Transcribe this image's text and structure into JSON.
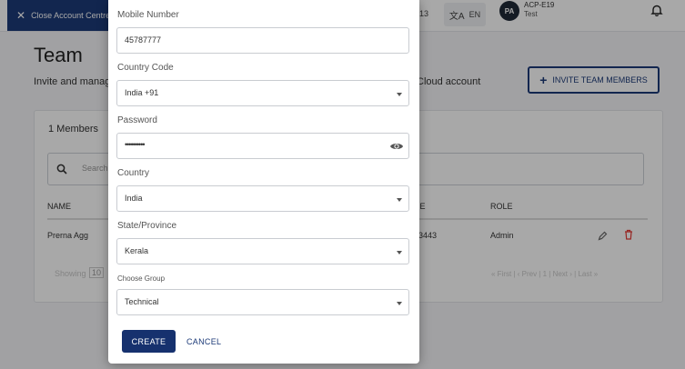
{
  "header": {
    "close_label": "Close Account Centre",
    "balance": "INR 5,600.13",
    "language": "EN",
    "avatar_initials": "PA",
    "account_name": "ACP-E19",
    "account_sub": "Test"
  },
  "page": {
    "title": "Team",
    "subtitle_start": "Invite and manag",
    "subtitle_end": "Cloud account",
    "invite_label": "INVITE TEAM MEMBERS"
  },
  "members": {
    "count_label": "1 Members",
    "search_placeholder": "Search",
    "columns": [
      "NAME",
      "NE",
      "ROLE"
    ],
    "rows": [
      {
        "name": "Prerna Agg",
        "phone": "53443",
        "role": "Admin"
      }
    ],
    "showing_label": "Showing",
    "page_size": "10",
    "pager": "« First | ‹ Prev | 1 | Next › | Last »"
  },
  "form": {
    "mobile": {
      "label": "Mobile Number",
      "value": "45787777"
    },
    "country_code": {
      "label": "Country Code",
      "value": "India +91"
    },
    "password": {
      "label": "Password",
      "value": "••••••••••"
    },
    "country": {
      "label": "Country",
      "value": "India"
    },
    "state": {
      "label": "State/Province",
      "value": "Kerala"
    },
    "group": {
      "label": "Choose Group",
      "value": "Technical"
    },
    "create_label": "CREATE",
    "cancel_label": "CANCEL"
  },
  "colors": {
    "primary": "#16316e",
    "delete": "#e53935"
  }
}
